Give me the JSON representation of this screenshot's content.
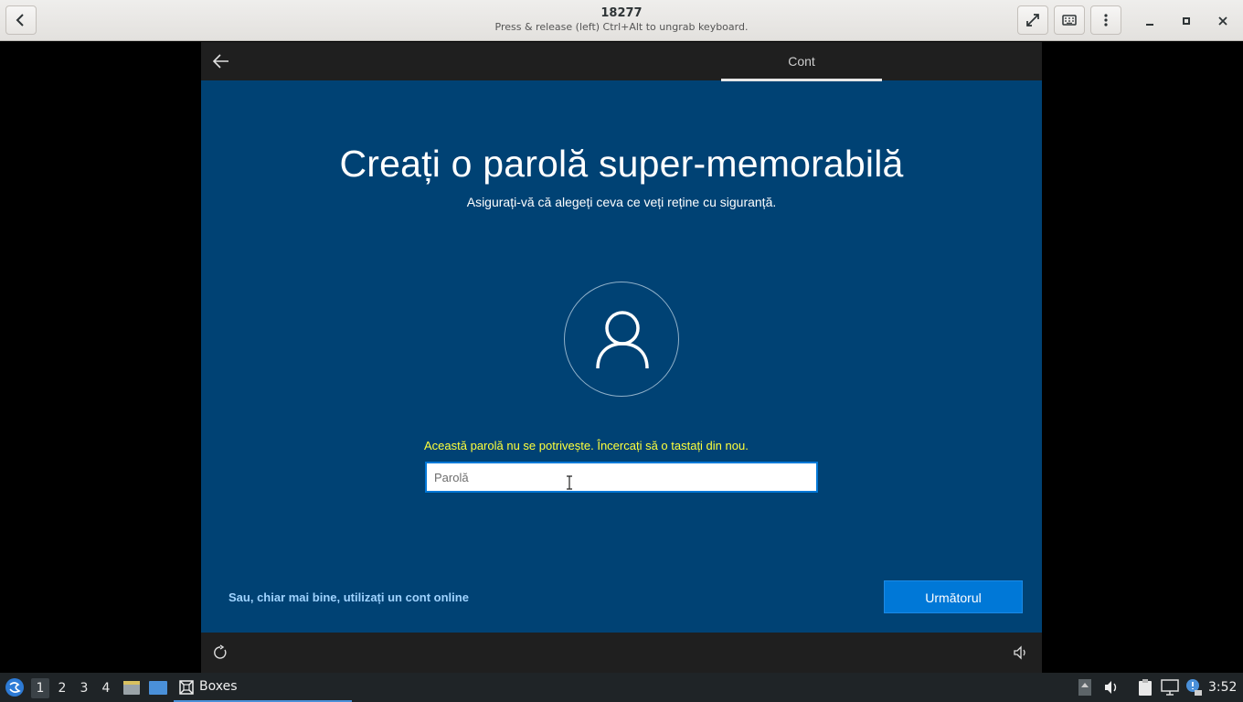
{
  "header": {
    "title": "18277",
    "subtitle": "Press & release (left) Ctrl+Alt to ungrab keyboard."
  },
  "vm": {
    "tab_label": "Cont",
    "title": "Creați o parolă super-memorabilă",
    "subtitle": "Asigurați-vă că alegeți ceva ce veți reține cu siguranță.",
    "error": "Această parolă nu se potrivește. Încercați să o tastați din nou.",
    "password": {
      "placeholder": "Parolă",
      "value": ""
    },
    "online_link": "Sau, chiar mai bine, utilizați un cont online",
    "next_button": "Următorul"
  },
  "panel": {
    "workspaces": [
      "1",
      "2",
      "3",
      "4"
    ],
    "active_workspace": "1",
    "task_label": "Boxes",
    "clock": "3:52"
  },
  "colors": {
    "vm_background": "#004274",
    "accent": "#0078d7",
    "error_text": "#ffff3b",
    "link": "#9fd3ff"
  }
}
